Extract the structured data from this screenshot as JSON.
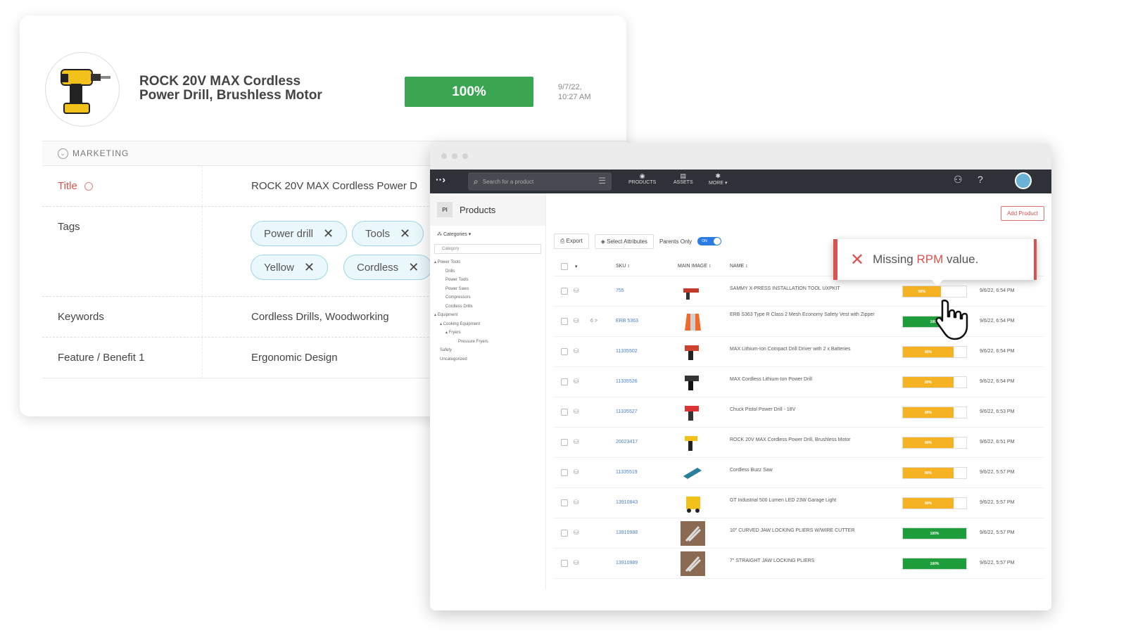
{
  "product": {
    "title": "ROCK 20V MAX Cordless Power Drill, Brushless Motor",
    "score": "100%",
    "date_line1": "9/7/22,",
    "date_line2": "10:27 AM"
  },
  "marketing": {
    "section_label": "MARKETING",
    "fields": {
      "title_label": "Title",
      "title_value": "ROCK 20V MAX Cordless Power D",
      "tags_label": "Tags",
      "tags": [
        "Power drill",
        "Tools",
        "Yellow",
        "Cordless"
      ],
      "keywords_label": "Keywords",
      "keywords_value": "Cordless Drills, Woodworking",
      "feature_label": "Feature / Benefit 1",
      "feature_value": "Ergonomic Design"
    }
  },
  "app": {
    "nav": {
      "search_placeholder": "Search for a product",
      "items": [
        "PRODUCTS",
        "ASSETS",
        "MORE ▾"
      ]
    },
    "sidebar": {
      "header": "Products",
      "header_icon": "PI",
      "categories_button": "Categories ▾",
      "category_select": "Category",
      "tree": [
        "Power Tools",
        "Drills",
        "Power Tools",
        "Power Saws",
        "Compressors",
        "Cordless Drills",
        "Equipment",
        "Cooking Equipment",
        "Fryers",
        "Pressure Fryers",
        "Safety",
        "Uncategorized"
      ]
    },
    "toolbar": {
      "add_product": "Add Product",
      "export": "Export",
      "select_attributes": "Select Attributes",
      "parents_only": "Parents Only",
      "toggle": "ON"
    },
    "columns": {
      "sku": "SKU ↕",
      "main_image": "MAIN IMAGE ↕",
      "name": "NAME ↕"
    },
    "rows": [
      {
        "sku": "755",
        "name": "SAMMY X-PRESS INSTALLATION TOOL UXPKIT",
        "pct": 60,
        "pct_label": "60%",
        "date": "9/6/22, 6:54 PM"
      },
      {
        "sku": "ERB 5363",
        "name": "ERB S363 Type R Class 2 Mesh Economy Safety Vest with Zipper",
        "pct": 100,
        "pct_label": "100%",
        "date": "9/6/22, 6:54 PM",
        "children": "6 >"
      },
      {
        "sku": "11335502",
        "name": "MAX Lithium-Ion Compact Drill Driver with 2 x Batteries",
        "pct": 80,
        "pct_label": "80%",
        "date": "9/6/22, 6:54 PM"
      },
      {
        "sku": "11335526",
        "name": "MAX Cordless Lithium-Ion Power Drill",
        "pct": 80,
        "pct_label": "80%",
        "date": "9/6/22, 6:54 PM"
      },
      {
        "sku": "11335527",
        "name": "Chuck Pistol Power Drill - 18V",
        "pct": 80,
        "pct_label": "80%",
        "date": "9/6/22, 6:53 PM"
      },
      {
        "sku": "20023417",
        "name": "ROCK 20V MAX Cordless Power Drill, Brushless Motor",
        "pct": 80,
        "pct_label": "80%",
        "date": "9/6/22, 6:51 PM"
      },
      {
        "sku": "11335519",
        "name": "Cordless Buzz Saw",
        "pct": 80,
        "pct_label": "80%",
        "date": "9/6/22, 5:57 PM"
      },
      {
        "sku": "13910843",
        "name": "GT Industrial 500 Lumen LED 23W Garage Light",
        "pct": 80,
        "pct_label": "80%",
        "date": "9/6/22, 5:57 PM"
      },
      {
        "sku": "13910988",
        "name": "10\" CURVED JAW LOCKING PLIERS W/WIRE CUTTER",
        "pct": 100,
        "pct_label": "100%",
        "date": "9/6/22, 5:57 PM"
      },
      {
        "sku": "13910989",
        "name": "7\" STRAIGHT JAW LOCKING PLIERS",
        "pct": 100,
        "pct_label": "100%",
        "date": "9/6/22, 5:57 PM"
      }
    ]
  },
  "tooltip": {
    "pre": "Missing ",
    "highlight": "RPM",
    "post": " value."
  },
  "colors": {
    "green": "#3ba652",
    "progress_green": "#1e9e3a",
    "progress_yellow": "#f5b324",
    "alert_red": "#d9534f",
    "nav_dark": "#2e3138",
    "toggle_blue": "#2a7be4"
  }
}
